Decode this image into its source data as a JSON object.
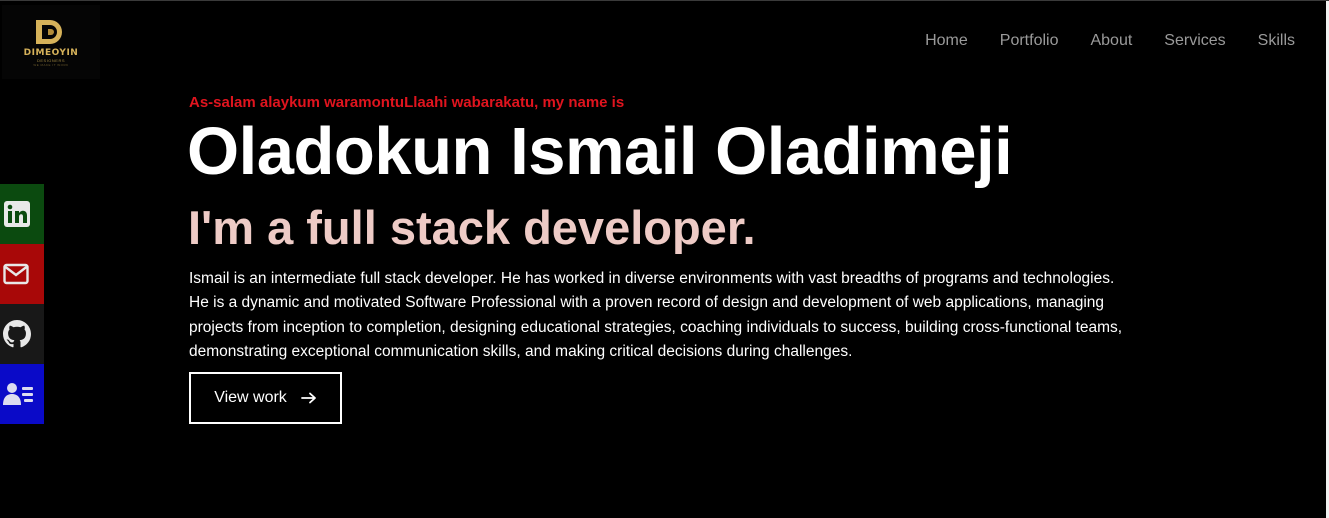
{
  "brand": {
    "logo_letter": "D",
    "name": "DIMEOYIN",
    "tagline": "DESIGNERS",
    "tagline2": "WE MAKE IT WORK",
    "color": "#d6b25a"
  },
  "nav": {
    "items": [
      {
        "label": "Home"
      },
      {
        "label": "Portfolio"
      },
      {
        "label": "About"
      },
      {
        "label": "Services"
      },
      {
        "label": "Skills"
      }
    ]
  },
  "social": {
    "items": [
      {
        "icon": "linkedin-icon",
        "color": "#0b4a0f"
      },
      {
        "icon": "mail-icon",
        "color": "#a80808"
      },
      {
        "icon": "github-icon",
        "color": "#181818"
      },
      {
        "icon": "resume-icon",
        "color": "#0a0ac8"
      }
    ]
  },
  "hero": {
    "greeting": "As-salam alaykum waramontuLlaahi wabarakatu, my name is",
    "name": "Oladokun Ismail Oladimeji",
    "role": "I'm a full stack developer.",
    "description": "Ismail is an intermediate full stack developer. He has worked in diverse environments with vast breadths of programs and technologies. He is a dynamic and motivated Software Professional with a proven record of design and development of web applications, managing projects from inception to completion, designing educational strategies, coaching individuals to success, building cross-functional teams, demonstrating exceptional communication skills, and making critical decisions during challenges.",
    "cta_label": "View work",
    "cta_icon": "arrow-right-icon"
  },
  "colors": {
    "background": "#000000",
    "greeting": "#e0141e",
    "role": "#eecbc6",
    "nav_text": "#9a9a9a"
  }
}
